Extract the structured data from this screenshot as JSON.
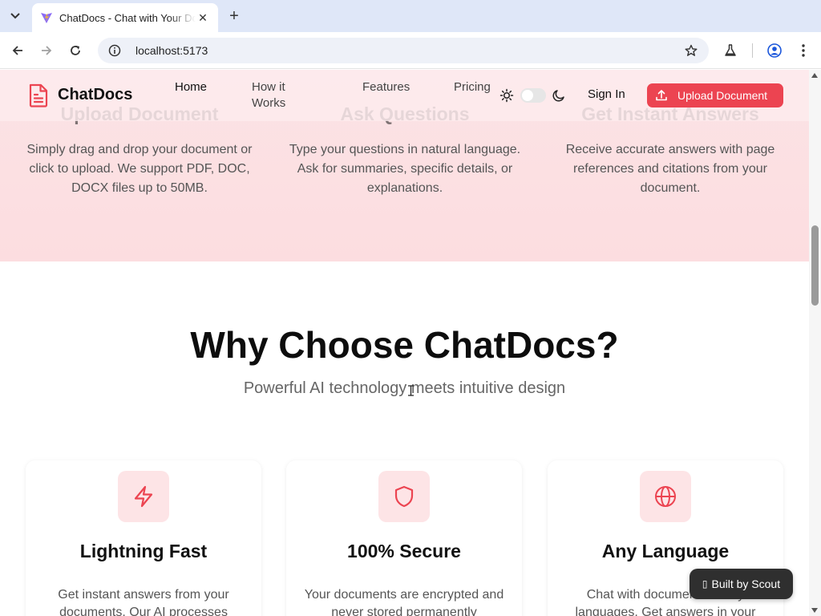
{
  "browser": {
    "tab_title": "ChatDocs - Chat with Your Documents",
    "url": "localhost:5173"
  },
  "steps": [
    {
      "title": "Upload Document",
      "desc": "Simply drag and drop your document or click to upload. We support PDF, DOC, DOCX files up to 50MB."
    },
    {
      "title": "Ask Questions",
      "desc": "Type your questions in natural language. Ask for summaries, specific details, or explanations."
    },
    {
      "title": "Get Instant Answers",
      "desc": "Receive accurate answers with page references and citations from your document."
    }
  ],
  "nav": {
    "logo": "ChatDocs",
    "links": [
      "Home",
      "How it Works",
      "Features",
      "Pricing"
    ],
    "sign_in": "Sign In",
    "upload": "Upload Document"
  },
  "why": {
    "title": "Why Choose ChatDocs?",
    "subtitle": "Powerful AI technology meets intuitive design"
  },
  "features": [
    {
      "icon": "lightning-icon",
      "title": "Lightning Fast",
      "desc": "Get instant answers from your documents. Our AI processes"
    },
    {
      "icon": "shield-icon",
      "title": "100% Secure",
      "desc": "Your documents are encrypted and never stored permanently"
    },
    {
      "icon": "globe-icon",
      "title": "Any Language",
      "desc": "Chat with documents in any languages. Get answers in your"
    }
  ],
  "badge": {
    "label": "Built by Scout"
  },
  "colors": {
    "brand": "#ec4451",
    "brand_soft": "#fde4e6"
  }
}
